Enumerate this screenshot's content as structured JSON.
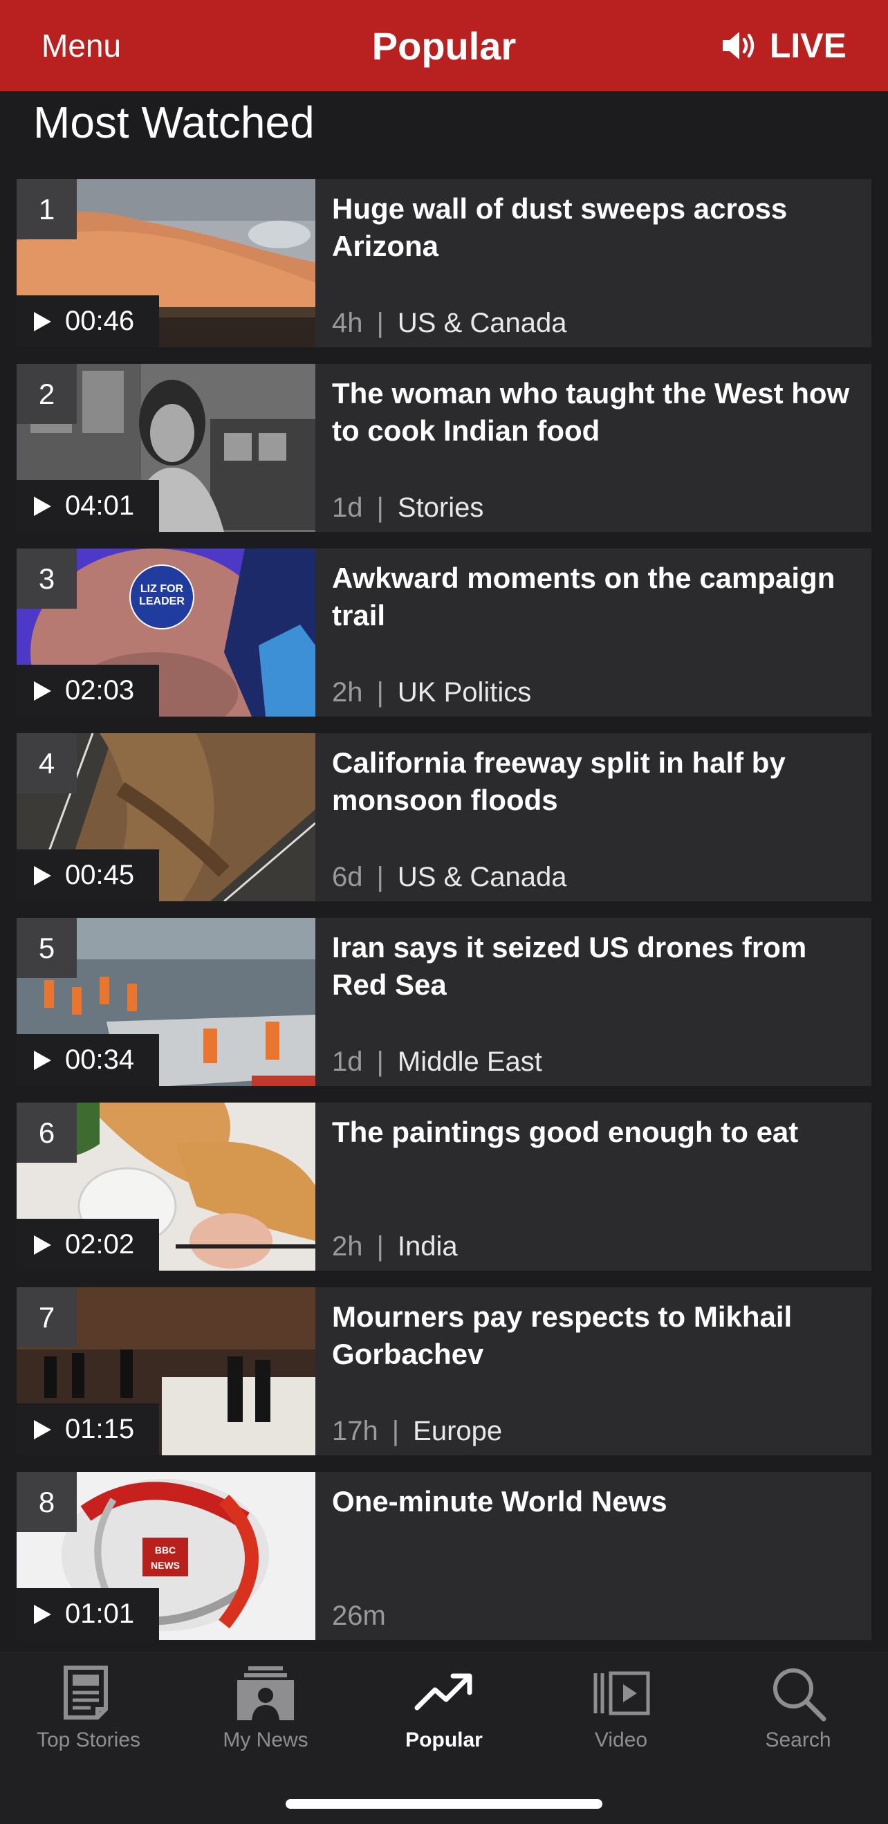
{
  "header": {
    "menu_label": "Menu",
    "title": "Popular",
    "live_label": "LIVE",
    "background_color": "#b8211f"
  },
  "section": {
    "heading": "Most Watched"
  },
  "items": [
    {
      "rank": "1",
      "duration": "00:46",
      "headline": "Huge wall of dust sweeps across Arizona",
      "age": "4h",
      "category": "US & Canada"
    },
    {
      "rank": "2",
      "duration": "04:01",
      "headline": "The woman who taught the West how to cook Indian food",
      "age": "1d",
      "category": "Stories"
    },
    {
      "rank": "3",
      "duration": "02:03",
      "headline": "Awkward moments on the campaign trail",
      "age": "2h",
      "category": "UK Politics"
    },
    {
      "rank": "4",
      "duration": "00:45",
      "headline": "California freeway split in half by monsoon floods",
      "age": "6d",
      "category": "US & Canada"
    },
    {
      "rank": "5",
      "duration": "00:34",
      "headline": "Iran says it seized US drones from Red Sea",
      "age": "1d",
      "category": "Middle East"
    },
    {
      "rank": "6",
      "duration": "02:02",
      "headline": "The paintings good enough to eat",
      "age": "2h",
      "category": "India"
    },
    {
      "rank": "7",
      "duration": "01:15",
      "headline": "Mourners pay respects to Mikhail Gorbachev",
      "age": "17h",
      "category": "Europe"
    },
    {
      "rank": "8",
      "duration": "01:01",
      "headline": "One-minute World News",
      "age": "26m",
      "category": ""
    }
  ],
  "thumb_text": {
    "badge_line1": "LIZ FOR",
    "badge_line2": "LEADER",
    "logo_line1": "BBC",
    "logo_line2": "NEWS"
  },
  "tabbar": {
    "tabs": [
      {
        "label": "Top Stories",
        "icon": "newspaper-icon",
        "active": false
      },
      {
        "label": "My News",
        "icon": "my-news-icon",
        "active": false
      },
      {
        "label": "Popular",
        "icon": "trending-icon",
        "active": true
      },
      {
        "label": "Video",
        "icon": "video-icon",
        "active": false
      },
      {
        "label": "Search",
        "icon": "search-icon",
        "active": false
      }
    ]
  }
}
